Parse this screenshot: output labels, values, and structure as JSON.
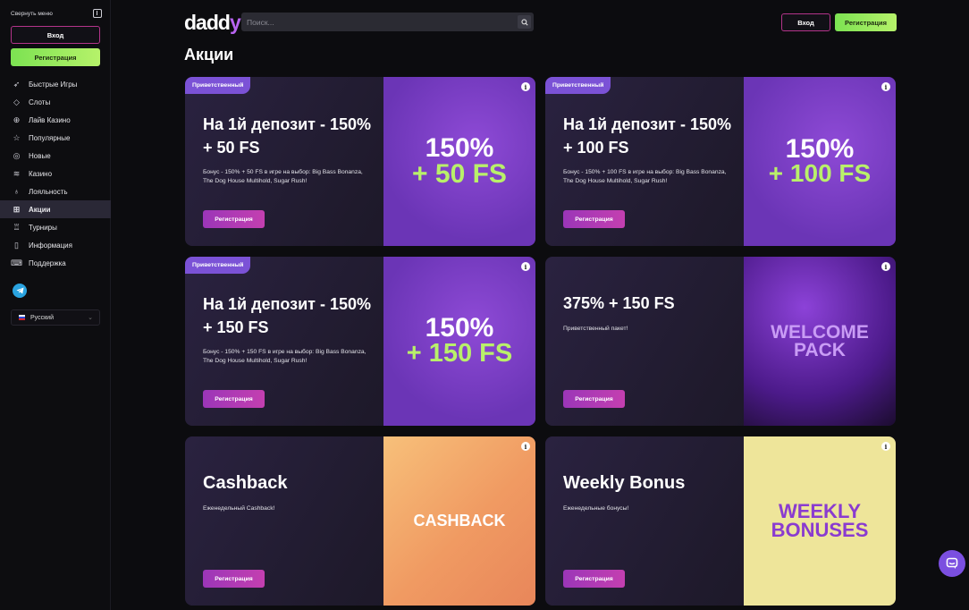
{
  "sidebar": {
    "collapse_label": "Свернуть меню",
    "login_label": "Вход",
    "register_label": "Регистрация",
    "items": [
      {
        "label": "Быстрые Игры",
        "icon": "rocket-icon"
      },
      {
        "label": "Слоты",
        "icon": "diamond-icon"
      },
      {
        "label": "Лайв Казино",
        "icon": "live-icon"
      },
      {
        "label": "Популярные",
        "icon": "star-icon"
      },
      {
        "label": "Новые",
        "icon": "new-icon"
      },
      {
        "label": "Казино",
        "icon": "coins-icon"
      },
      {
        "label": "Лояльность",
        "icon": "medal-icon"
      },
      {
        "label": "Акции",
        "icon": "gift-icon"
      },
      {
        "label": "Турниры",
        "icon": "trophy-icon"
      },
      {
        "label": "Информация",
        "icon": "document-icon"
      },
      {
        "label": "Поддержка",
        "icon": "support-icon"
      }
    ],
    "active_item": "Акции",
    "language": "Русский"
  },
  "header": {
    "logo": "daddy",
    "search_placeholder": "Поиск...",
    "login_label": "Вход",
    "register_label": "Регистрация"
  },
  "page_title": "Акции",
  "promos": [
    {
      "tag": "Приветственный",
      "title": "На 1й депозит - 150% + 50 FS",
      "desc": "Бонус - 150% + 50 FS в игре на выбор: Big Bass Bonanza, The Dog House Multihold, Sugar Rush!",
      "button": "Регистрация",
      "img_line1": "150%",
      "img_line2": "+ 50 FS"
    },
    {
      "tag": "Приветственный",
      "title": "На 1й депозит - 150% + 100 FS",
      "desc": "Бонус - 150% + 100 FS в игре на выбор: Big Bass Bonanza, The Dog House Multihold, Sugar Rush!",
      "button": "Регистрация",
      "img_line1": "150%",
      "img_line2": "+ 100 FS"
    },
    {
      "tag": "Приветственный",
      "title": "На 1й депозит - 150% + 150 FS",
      "desc": "Бонус - 150% + 150 FS в игре на выбор: Big Bass Bonanza, The Dog House Multihold, Sugar Rush!",
      "button": "Регистрация",
      "img_line1": "150%",
      "img_line2": "+ 150 FS"
    },
    {
      "tag": "",
      "title": "375% + 150 FS",
      "desc": "Приветственный пакет!",
      "button": "Регистрация",
      "img_line1": "WELCOME",
      "img_line2": "PACK"
    },
    {
      "tag": "",
      "title": "Cashback",
      "desc": "Еженедельный Cashback!",
      "button": "Регистрация",
      "img_line1": "CASHBACK",
      "img_line2": ""
    },
    {
      "tag": "",
      "title": "Weekly Bonus",
      "desc": "Еженедельные бонусы!",
      "button": "Регистрация",
      "img_line1": "WEEKLY",
      "img_line2": "BONUSES"
    }
  ],
  "colors": {
    "accent_green": "#7ce252",
    "accent_magenta": "#b3348a",
    "tag_purple": "#7b52d6"
  }
}
